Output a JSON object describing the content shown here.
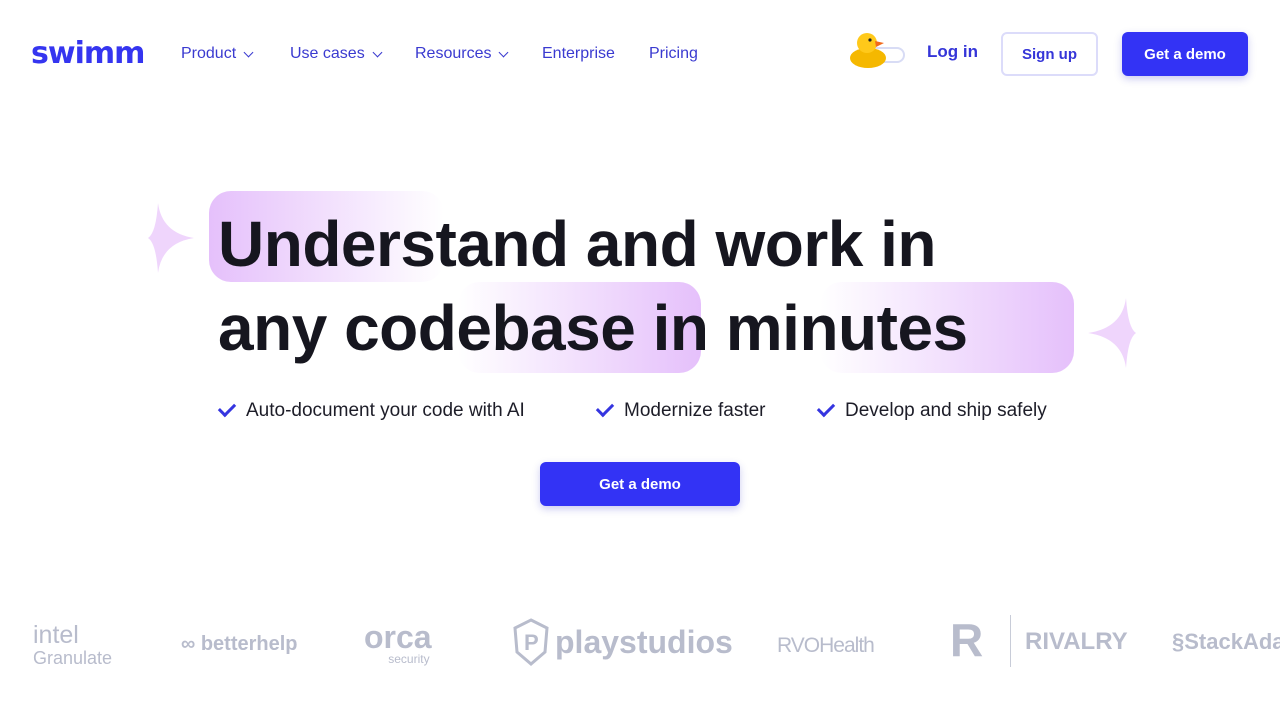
{
  "header": {
    "logo": "swim",
    "logo_suffix": "m",
    "nav": [
      {
        "label": "Product",
        "dropdown": true
      },
      {
        "label": "Use cases",
        "dropdown": true
      },
      {
        "label": "Resources",
        "dropdown": true
      },
      {
        "label": "Enterprise",
        "dropdown": false
      },
      {
        "label": "Pricing",
        "dropdown": false
      }
    ],
    "login": "Log in",
    "signup": "Sign up",
    "demo": "Get a demo"
  },
  "hero": {
    "line1_highlight": "Under",
    "line1_rest": "stand and work in",
    "line2_a": "any ",
    "line2_highlight": "codebase",
    "line2_b": " in ",
    "line2_highlight2": "minutes",
    "checks": [
      "Auto-document your code with AI",
      "Modernize faster",
      "Develop and ship safely"
    ],
    "cta": "Get a demo"
  },
  "logos": [
    "intel",
    "Granulate",
    "betterhelp",
    "orca",
    "security",
    "playstudios",
    "RVOHealth",
    "RIVALRY",
    "StackAdapt"
  ],
  "colors": {
    "accent": "#3333f5",
    "highlight": "#e6c4fb"
  }
}
